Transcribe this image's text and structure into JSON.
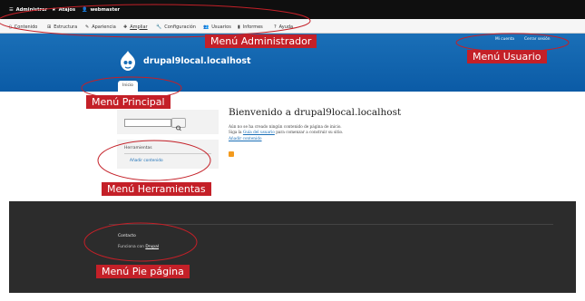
{
  "toolbar": {
    "top": {
      "manage": "Administrar",
      "shortcuts": "Atajos",
      "user": "webmaster"
    },
    "menu": {
      "content": "Contenido",
      "structure": "Estructura",
      "appearance": "Apariencia",
      "extend": "Ampliar",
      "config": "Configuración",
      "people": "Usuarios",
      "reports": "Informes",
      "help": "Ayuda"
    }
  },
  "header": {
    "site_name": "drupal9local.localhost",
    "my_account": "Mi cuenta",
    "logout": "Cerrar sesión"
  },
  "nav": {
    "home_tab": "Inicio"
  },
  "sidebar": {
    "tools_title": "Herramientas",
    "add_content": "Añadir contenido"
  },
  "main": {
    "welcome_title": "Bienvenido a drupal9local.localhost",
    "line1": "Aún no se ha creado ningún contenido de página de inicio.",
    "line2_pre": "Siga la",
    "line2_link": "Guía del usuario",
    "line2_post": "para comenzar a construir su sitio.",
    "add_content_link": "Añadir contenido"
  },
  "footer": {
    "contact": "Contacto",
    "powered_pre": "Funciona con",
    "powered_link": "Drupal"
  },
  "annotations": {
    "admin": "Menú Administrador",
    "user": "Menú Usuario",
    "main": "Menú Principal",
    "tools": "Menú Herramientas",
    "footer": "Menú Pie página"
  },
  "colors": {
    "annotation": "#c42028",
    "header_blue": "#1a6fb7",
    "footer_dark": "#2c2c2c"
  }
}
